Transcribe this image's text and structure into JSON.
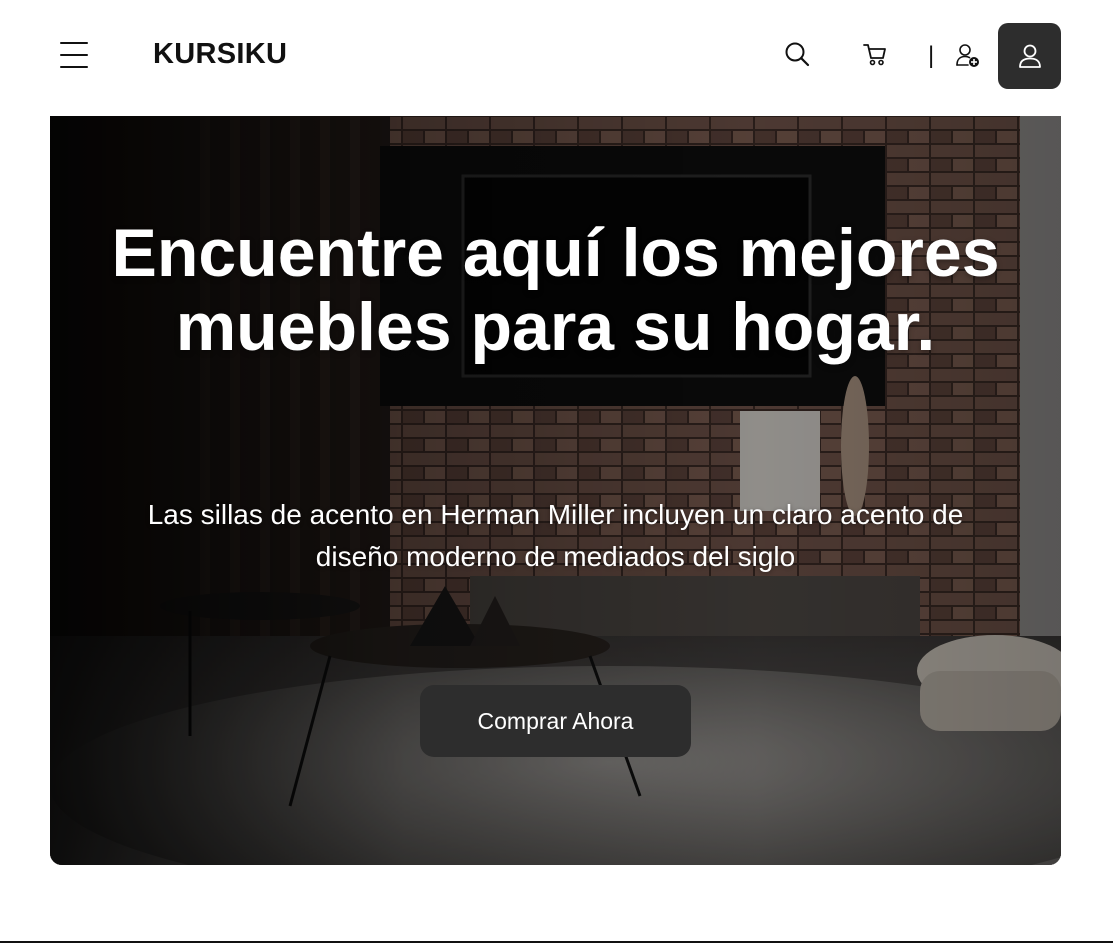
{
  "header": {
    "logo": "KURSIKU",
    "divider": "|",
    "icons": {
      "menu": "hamburger-menu-icon",
      "search": "search-icon",
      "cart": "cart-icon",
      "add_user": "user-add-icon",
      "account": "user-icon"
    }
  },
  "hero": {
    "title": "Encuentre aquí los mejores muebles para su hogar.",
    "subtitle": "Las sillas de acento en Herman Miller incluyen un claro acento de diseño moderno de mediados del siglo",
    "cta_label": "Comprar Ahora"
  },
  "colors": {
    "accent_dark": "#2d2d2d",
    "background": "#ffffff",
    "text": "#111111",
    "hero_text": "#ffffff"
  }
}
